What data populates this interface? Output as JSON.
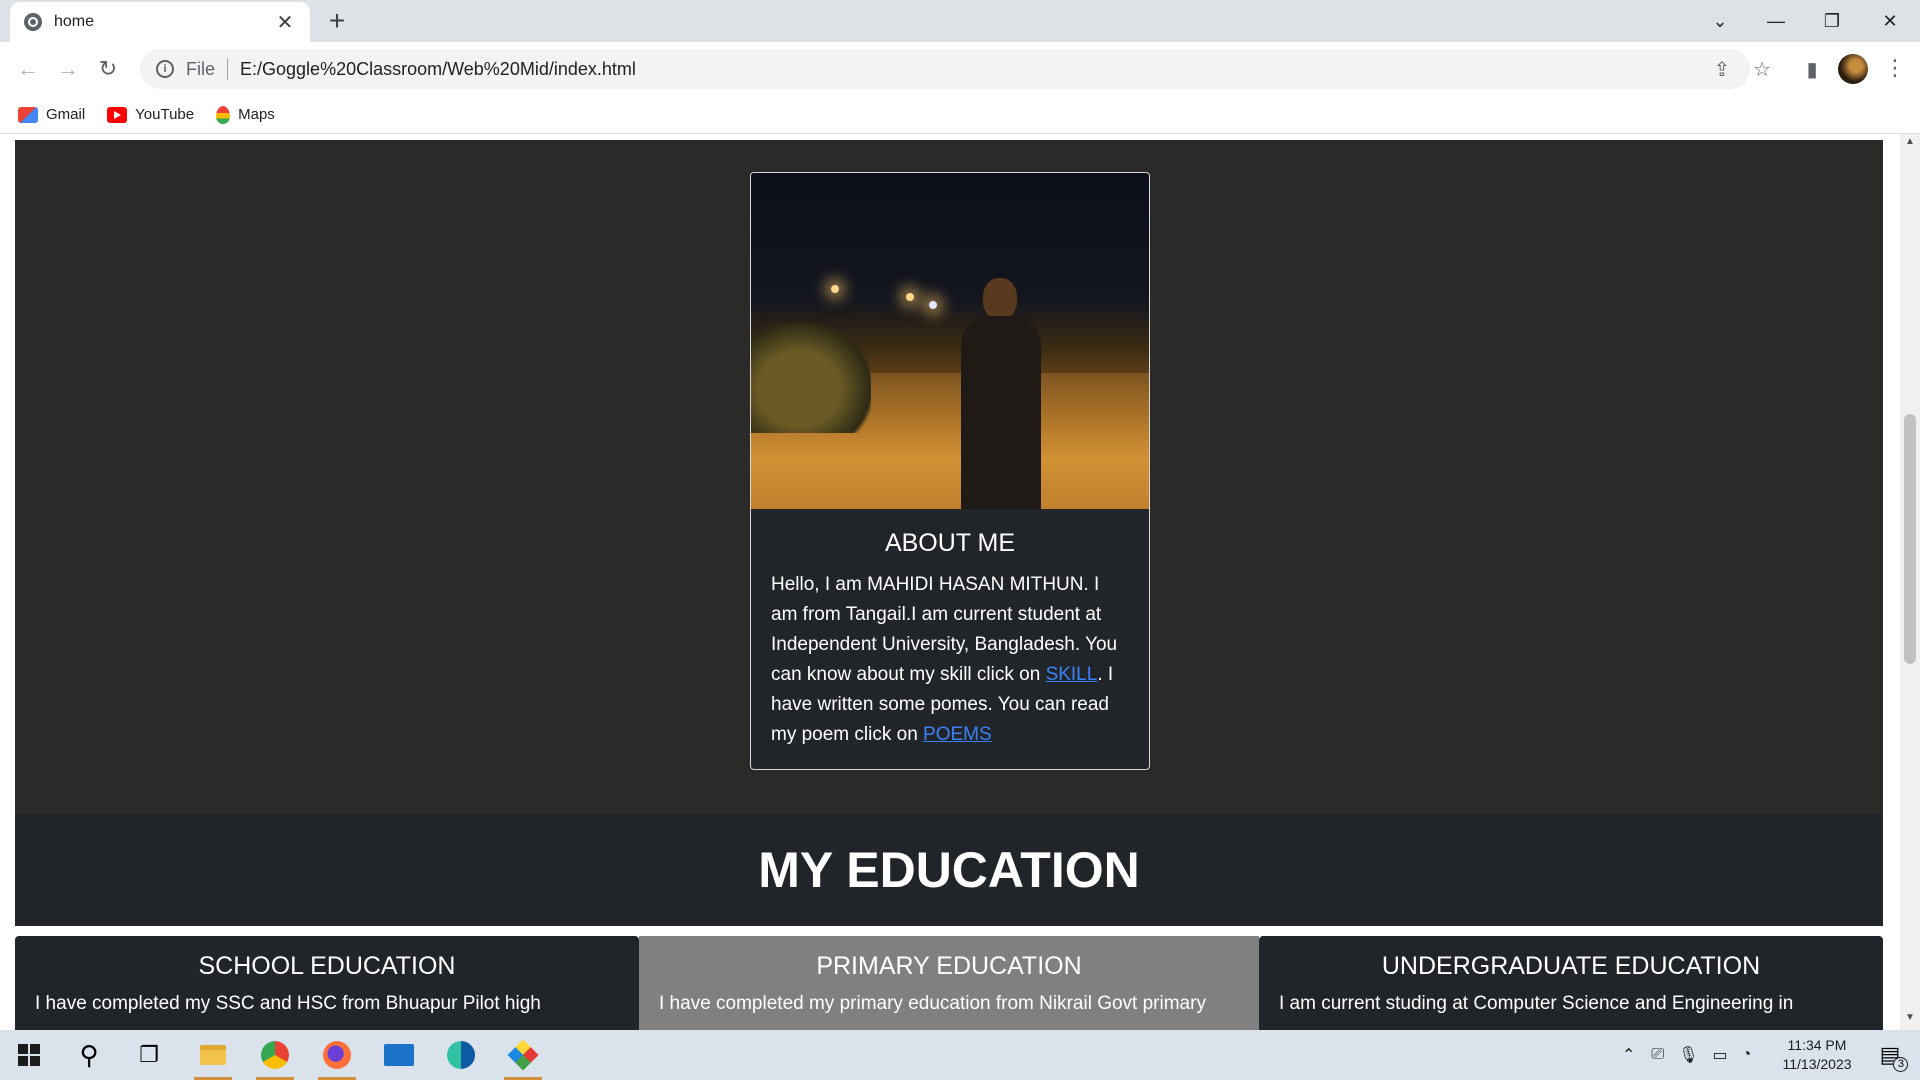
{
  "browser": {
    "tab_title": "home",
    "tab_close": "✕",
    "new_tab": "+",
    "window_controls": {
      "tab_search": "⌄",
      "minimize": "—",
      "restore": "❐",
      "close": "✕"
    },
    "omnibox": {
      "scheme": "File",
      "url": "E:/Goggle%20Classroom/Web%20Mid/index.html"
    },
    "bookmarks": [
      {
        "label": "Gmail",
        "icon": "gmail-icon"
      },
      {
        "label": "YouTube",
        "icon": "youtube-icon"
      },
      {
        "label": "Maps",
        "icon": "maps-icon"
      }
    ]
  },
  "about": {
    "title": "ABOUT ME",
    "text_1": "Hello, I am MAHIDI HASAN MITHUN. I am from Tangail.I am current student at Independent University, Bangladesh. You can know about my skill click on ",
    "skill_link": "SKILL",
    "text_2": ". I have written some pomes. You can read my poem click on ",
    "poems_link": "POEMS"
  },
  "education": {
    "heading": "MY EDUCATION",
    "columns": [
      {
        "title": "SCHOOL EDUCATION",
        "text": "I have completed my SSC and HSC from Bhuapur Pilot high",
        "bg": "#212529"
      },
      {
        "title": "PRIMARY EDUCATION",
        "text": "I have completed my primary education from Nikrail Govt primary",
        "bg": "#808080"
      },
      {
        "title": "UNDERGRADUATE EDUCATION",
        "text": "I am current studing at Computer Science and Engineering in",
        "bg": "#212529"
      }
    ]
  },
  "taskbar": {
    "clock_time": "11:34 PM",
    "clock_date": "11/13/2023",
    "notification_count": "3"
  },
  "colors": {
    "about_bg": "#2c2a28",
    "card_bg": "#212529",
    "link": "#3b82f6",
    "taskbar_active": "#d08f3b"
  }
}
